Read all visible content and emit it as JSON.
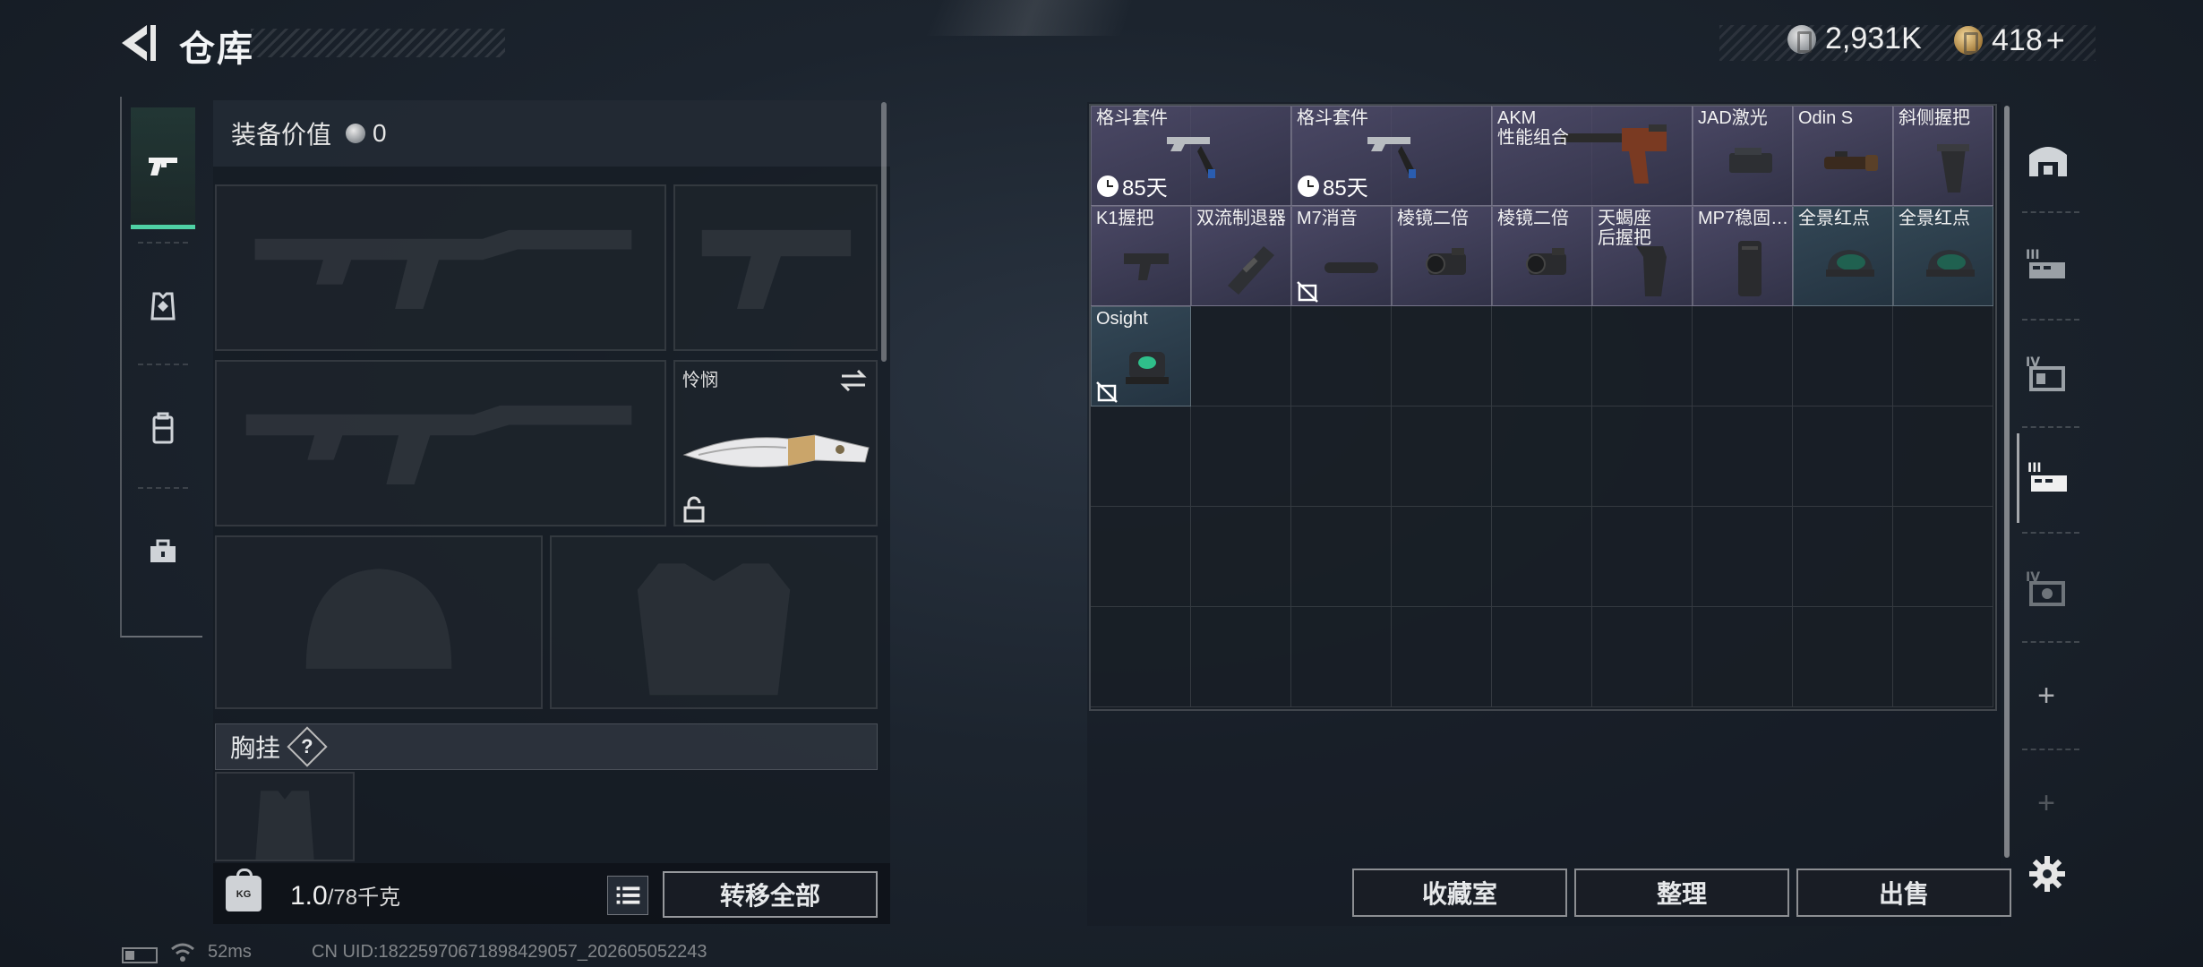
{
  "header": {
    "title": "仓库",
    "currency_silver": "2,931K",
    "currency_gold": "418",
    "add_label": "+"
  },
  "equipment": {
    "value_label": "装备价值",
    "value": "0",
    "knife_name": "怜悯",
    "chest_rig_label": "胸挂",
    "help_label": "?",
    "weight_current": "1.0",
    "weight_capacity": "/78千克",
    "transfer_all_label": "转移全部"
  },
  "warehouse": {
    "items": [
      {
        "name": "格斗套件",
        "timer": "85天",
        "rarity": "purple",
        "icon": "melee-kit"
      },
      {
        "name": "格斗套件",
        "timer": "85天",
        "rarity": "purple",
        "icon": "melee-kit"
      },
      {
        "name": "AKM\n性能组合",
        "rarity": "purple",
        "icon": "akm-kit"
      },
      {
        "name": "JAD激光",
        "rarity": "purple",
        "icon": "laser"
      },
      {
        "name": "Odin S",
        "rarity": "purple",
        "icon": "flashlight"
      },
      {
        "name": "斜侧握把",
        "rarity": "purple",
        "icon": "angled-grip"
      },
      {
        "name": "K1握把",
        "rarity": "purple",
        "icon": "stock"
      },
      {
        "name": "双流制退器",
        "rarity": "purple",
        "icon": "muzzle-brake"
      },
      {
        "name": "M7消音",
        "rarity": "purple",
        "icon": "suppressor",
        "no_loot": true
      },
      {
        "name": "棱镜二倍",
        "rarity": "purple",
        "icon": "prism-scope"
      },
      {
        "name": "棱镜二倍",
        "rarity": "purple",
        "icon": "prism-scope"
      },
      {
        "name": "天蝎座\n后握把",
        "rarity": "purple",
        "icon": "pistol-grip"
      },
      {
        "name": "MP7稳固…",
        "rarity": "purple",
        "icon": "mag-grip"
      },
      {
        "name": "全景红点",
        "rarity": "blue",
        "icon": "holo-sight"
      },
      {
        "name": "全景红点",
        "rarity": "blue",
        "icon": "holo-sight"
      },
      {
        "name": "Osight",
        "rarity": "blue",
        "icon": "osight",
        "no_loot": true
      }
    ]
  },
  "actions": {
    "collection_label": "收藏室",
    "sort_label": "整理",
    "sell_label": "出售"
  },
  "status_bar": {
    "ping": "52ms",
    "uid": "CN UID:18225970671898429057_202605052243"
  },
  "colors": {
    "accent_green": "#4fd1a5",
    "item_purple": "#5c567a",
    "item_blue": "#3a5262"
  }
}
